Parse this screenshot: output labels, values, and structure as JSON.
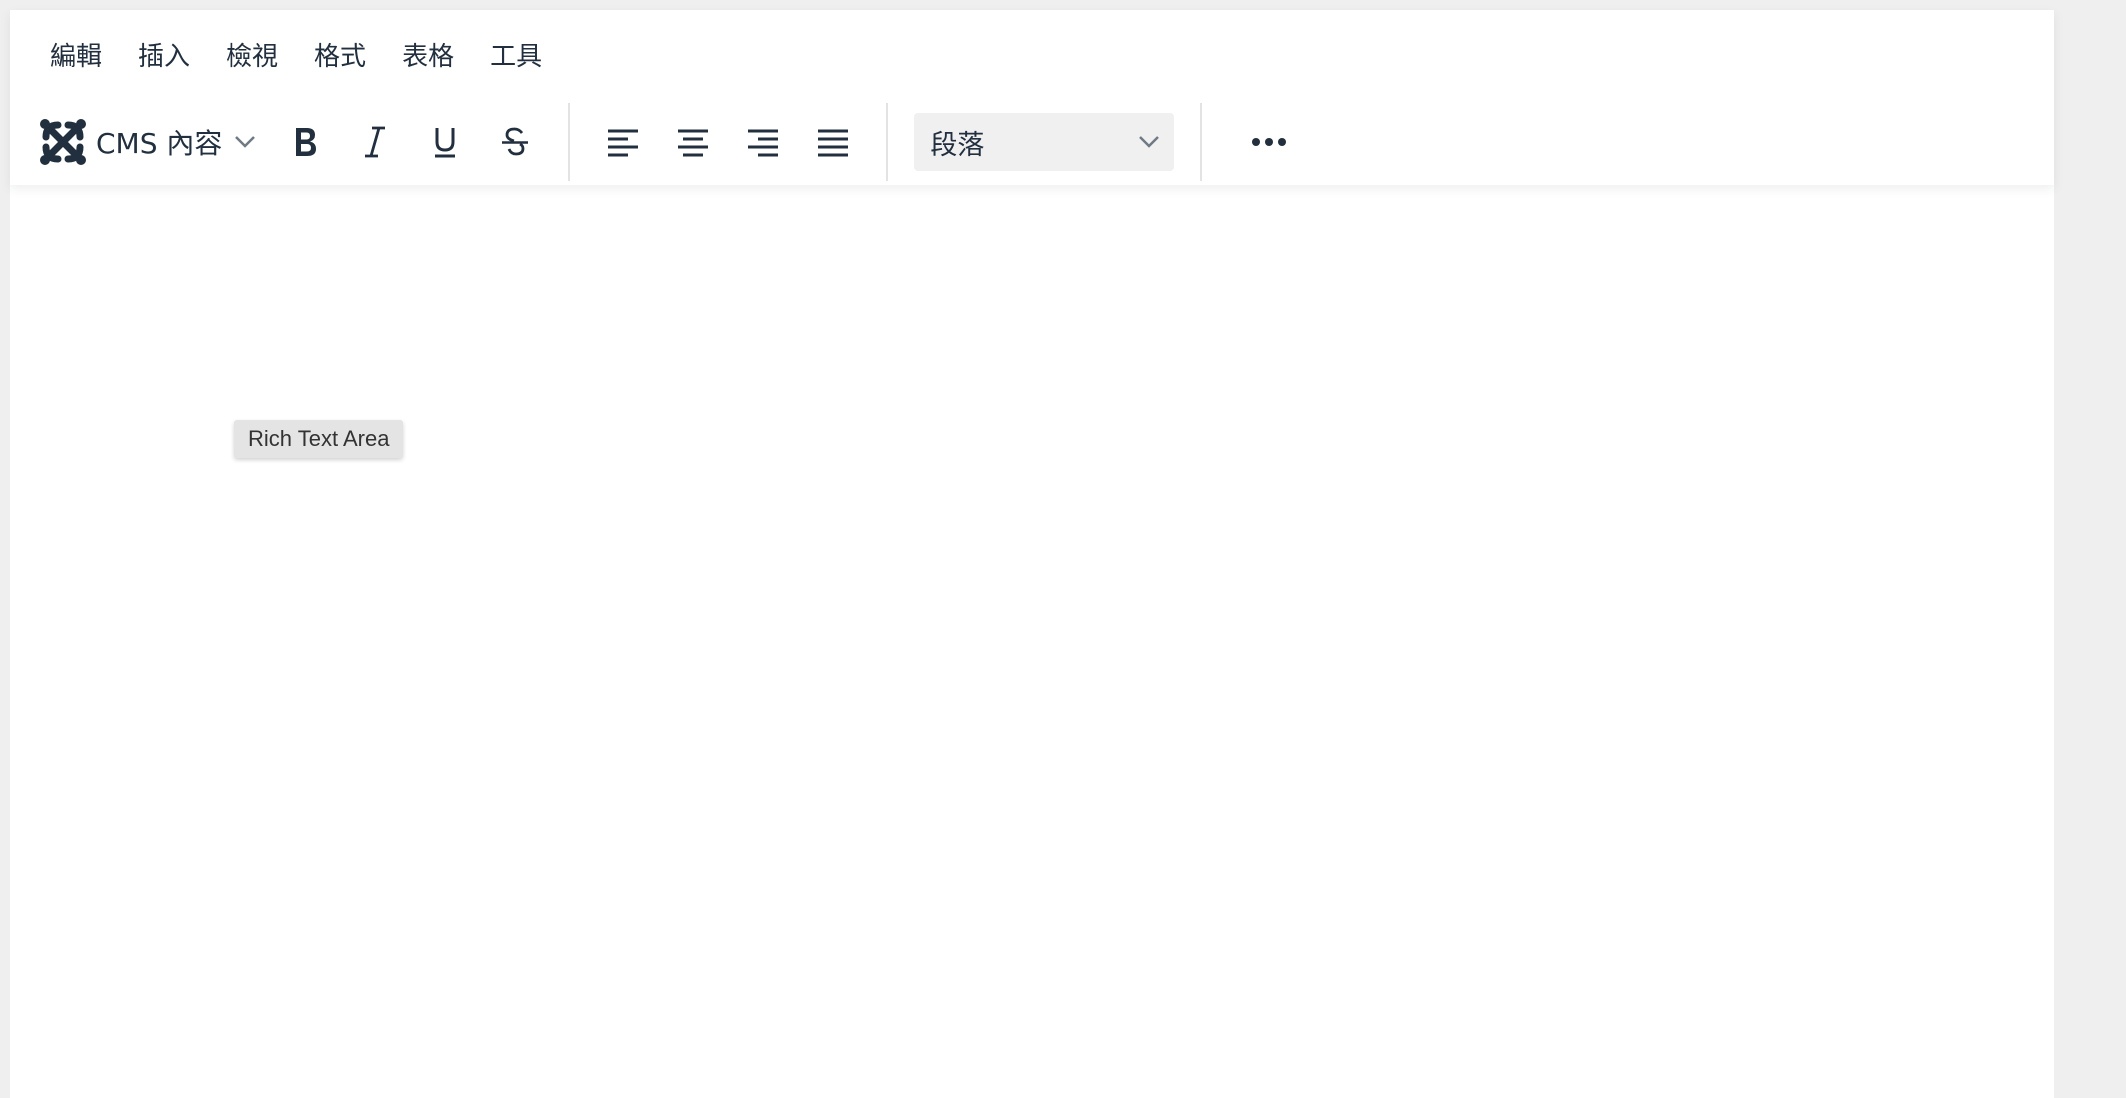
{
  "menubar": {
    "items": [
      {
        "label": "編輯"
      },
      {
        "label": "插入"
      },
      {
        "label": "檢視"
      },
      {
        "label": "格式"
      },
      {
        "label": "表格"
      },
      {
        "label": "工具"
      }
    ]
  },
  "toolbar": {
    "cms_button": {
      "label": "CMS 內容",
      "icon": "joomla-logo-icon"
    },
    "format_buttons": [
      {
        "name": "bold",
        "icon": "bold-icon"
      },
      {
        "name": "italic",
        "icon": "italic-icon"
      },
      {
        "name": "underline",
        "icon": "underline-icon"
      },
      {
        "name": "strikethrough",
        "icon": "strikethrough-icon"
      }
    ],
    "align_buttons": [
      {
        "name": "align-left",
        "icon": "align-left-icon"
      },
      {
        "name": "align-center",
        "icon": "align-center-icon"
      },
      {
        "name": "align-right",
        "icon": "align-right-icon"
      },
      {
        "name": "align-justify",
        "icon": "align-justify-icon"
      }
    ],
    "block_format": {
      "selected": "段落"
    },
    "more_button": {
      "icon": "more-horizontal-icon"
    }
  },
  "content": {
    "tooltip": "Rich Text Area"
  },
  "colors": {
    "text": "#222f3e",
    "background": "#efefef",
    "editor": "#ffffff",
    "select_bg": "#f0f0f0",
    "tooltip_bg": "#e4e4e4"
  }
}
